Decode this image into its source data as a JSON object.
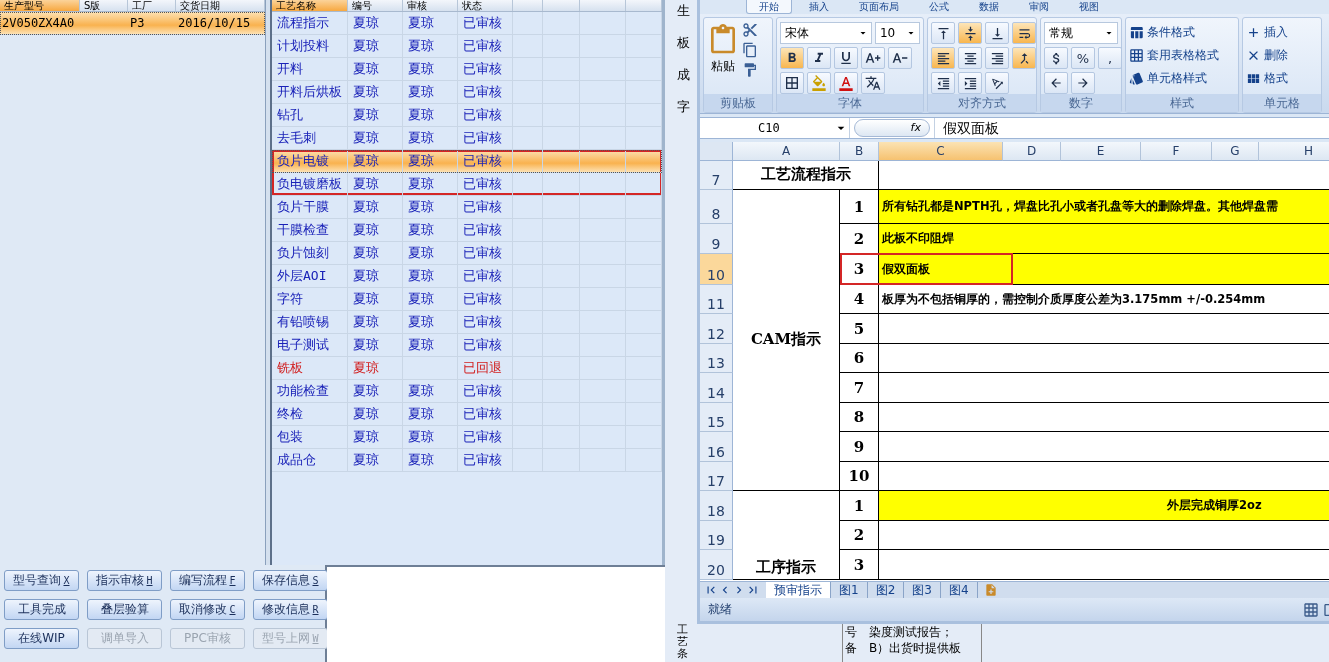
{
  "order_list": {
    "columns": [
      "生产型号",
      "S版",
      "工厂",
      "交货日期"
    ],
    "rows": [
      {
        "cells": [
          "2V050ZX4A0",
          "",
          "P3",
          "2016/10/15"
        ],
        "selected": true
      }
    ]
  },
  "process_table": {
    "columns": [
      "工艺名称",
      "编号",
      "审核",
      "状态"
    ],
    "rows": [
      {
        "cells": [
          "流程指示",
          "夏琼",
          "夏琼",
          "已审核"
        ],
        "kind": "approved",
        "selected": false,
        "outlined": false
      },
      {
        "cells": [
          "计划投料",
          "夏琼",
          "夏琼",
          "已审核"
        ],
        "kind": "approved",
        "selected": false,
        "outlined": false
      },
      {
        "cells": [
          "开料",
          "夏琼",
          "夏琼",
          "已审核"
        ],
        "kind": "approved",
        "selected": false,
        "outlined": false
      },
      {
        "cells": [
          "开料后烘板",
          "夏琼",
          "夏琼",
          "已审核"
        ],
        "kind": "approved",
        "selected": false,
        "outlined": false
      },
      {
        "cells": [
          "钻孔",
          "夏琼",
          "夏琼",
          "已审核"
        ],
        "kind": "approved",
        "selected": false,
        "outlined": false
      },
      {
        "cells": [
          "去毛刺",
          "夏琼",
          "夏琼",
          "已审核"
        ],
        "kind": "approved",
        "selected": false,
        "outlined": false
      },
      {
        "cells": [
          "负片电镀",
          "夏琼",
          "夏琼",
          "已审核"
        ],
        "kind": "approved",
        "selected": true,
        "outlined": true
      },
      {
        "cells": [
          "负电镀磨板",
          "夏琼",
          "夏琼",
          "已审核"
        ],
        "kind": "approved",
        "selected": false,
        "outlined": true
      },
      {
        "cells": [
          "负片干膜",
          "夏琼",
          "夏琼",
          "已审核"
        ],
        "kind": "approved",
        "selected": false,
        "outlined": false
      },
      {
        "cells": [
          "干膜检查",
          "夏琼",
          "夏琼",
          "已审核"
        ],
        "kind": "approved",
        "selected": false,
        "outlined": false
      },
      {
        "cells": [
          "负片蚀刻",
          "夏琼",
          "夏琼",
          "已审核"
        ],
        "kind": "approved",
        "selected": false,
        "outlined": false
      },
      {
        "cells": [
          "外层AOI",
          "夏琼",
          "夏琼",
          "已审核"
        ],
        "kind": "approved",
        "selected": false,
        "outlined": false
      },
      {
        "cells": [
          "字符",
          "夏琼",
          "夏琼",
          "已审核"
        ],
        "kind": "approved",
        "selected": false,
        "outlined": false
      },
      {
        "cells": [
          "有铅喷锡",
          "夏琼",
          "夏琼",
          "已审核"
        ],
        "kind": "approved",
        "selected": false,
        "outlined": false
      },
      {
        "cells": [
          "电子测试",
          "夏琼",
          "夏琼",
          "已审核"
        ],
        "kind": "approved",
        "selected": false,
        "outlined": false
      },
      {
        "cells": [
          "铣板",
          "夏琼",
          "",
          "已回退"
        ],
        "kind": "returned",
        "selected": false,
        "outlined": false
      },
      {
        "cells": [
          "功能检查",
          "夏琼",
          "夏琼",
          "已审核"
        ],
        "kind": "approved",
        "selected": false,
        "outlined": false
      },
      {
        "cells": [
          "终检",
          "夏琼",
          "夏琼",
          "已审核"
        ],
        "kind": "approved",
        "selected": false,
        "outlined": false
      },
      {
        "cells": [
          "包装",
          "夏琼",
          "夏琼",
          "已审核"
        ],
        "kind": "approved",
        "selected": false,
        "outlined": false
      },
      {
        "cells": [
          "成品仓",
          "夏琼",
          "夏琼",
          "已审核"
        ],
        "kind": "approved",
        "selected": false,
        "outlined": false
      }
    ]
  },
  "buttons": [
    {
      "label": "型号查询",
      "hotkey": "X",
      "disabled": false
    },
    {
      "label": "指示审核",
      "hotkey": "H",
      "disabled": false
    },
    {
      "label": "编写流程",
      "hotkey": "F",
      "disabled": false
    },
    {
      "label": "保存信息",
      "hotkey": "S",
      "disabled": false
    },
    {
      "label": "工具完成",
      "disabled": false
    },
    {
      "label": "叠层验算",
      "disabled": false
    },
    {
      "label": "取消修改",
      "hotkey": "C",
      "disabled": false
    },
    {
      "label": "修改信息",
      "hotkey": "R",
      "disabled": false
    },
    {
      "label": "在线WIP",
      "disabled": false
    },
    {
      "label": "调单导入",
      "disabled": true
    },
    {
      "label": "PPC审核",
      "disabled": true
    },
    {
      "label": "型号上网",
      "hotkey": "W",
      "disabled": true
    }
  ],
  "background_form": {
    "labels_top": [
      "生",
      "板",
      "成",
      "字"
    ],
    "labels_bottom": [
      "工",
      "艺",
      "条"
    ],
    "notes": [
      {
        "key": "号",
        "text": "染度测试报告；"
      },
      {
        "key": "备",
        "text": "B）出货时提供板"
      }
    ]
  },
  "excel": {
    "tabs": [
      {
        "label": "开始",
        "selected": true
      },
      {
        "label": "插入",
        "selected": false
      },
      {
        "label": "页面布局",
        "selected": false
      },
      {
        "label": "公式",
        "selected": false
      },
      {
        "label": "数据",
        "selected": false
      },
      {
        "label": "审阅",
        "selected": false
      },
      {
        "label": "视图",
        "selected": false
      }
    ],
    "ribbon": {
      "clipboard": {
        "title": "剪贴板",
        "paste": "粘贴"
      },
      "font": {
        "title": "字体",
        "name": "宋体",
        "size": "10",
        "bold": true
      },
      "alignment": {
        "title": "对齐方式",
        "buttons": [
          {
            "kind": "top",
            "selected": false
          },
          {
            "kind": "middle",
            "selected": true
          },
          {
            "kind": "bottom",
            "selected": false
          },
          {
            "kind": "wrap",
            "selected": true
          },
          {
            "kind": "left",
            "selected": true
          },
          {
            "kind": "center",
            "selected": false
          },
          {
            "kind": "right",
            "selected": false
          },
          {
            "kind": "merge",
            "selected": true
          }
        ]
      },
      "number": {
        "title": "数字",
        "format": "常规",
        "symbols": [
          "%",
          ","
        ]
      },
      "styles": {
        "title": "样式",
        "items": [
          "条件格式",
          "套用表格格式",
          "单元格样式"
        ]
      },
      "cells": {
        "title": "单元格",
        "items": [
          "插入",
          "删除",
          "格式"
        ]
      }
    },
    "name_box": "C10",
    "fx": "fx",
    "formula": "假双面板",
    "columns": [
      {
        "label": "A",
        "selected": false
      },
      {
        "label": "B",
        "selected": false
      },
      {
        "label": "C",
        "selected": true
      },
      {
        "label": "D",
        "selected": false
      },
      {
        "label": "E",
        "selected": false
      },
      {
        "label": "F",
        "selected": false
      },
      {
        "label": "G",
        "selected": false
      },
      {
        "label": "H",
        "selected": false
      }
    ],
    "sections": [
      {
        "kind": "title",
        "label": "工艺流程指示",
        "rows": [
          {
            "row": "7",
            "selected": false
          }
        ]
      },
      {
        "kind": "list",
        "label": "CAM指示",
        "rows": [
          {
            "row": "8",
            "number": "1",
            "text": "所有钻孔都是NPTH孔，焊盘比孔小或者孔盘等大的删除焊盘。其他焊盘需",
            "highlighted": true,
            "selected": false,
            "outlined": false
          },
          {
            "row": "9",
            "number": "2",
            "text": "此板不印阻焊",
            "highlighted": true,
            "selected": false,
            "outlined": false
          },
          {
            "row": "10",
            "number": "3",
            "text": "假双面板",
            "highlighted": true,
            "selected": true,
            "outlined": true
          },
          {
            "row": "11",
            "number": "4",
            "text": "板厚为不包括铜厚的，需控制介质厚度公差为3.175mm +/-0.254mm",
            "highlighted": false,
            "selected": false,
            "outlined": false
          },
          {
            "row": "12",
            "number": "5",
            "selected": false,
            "outlined": false
          },
          {
            "row": "13",
            "number": "6",
            "selected": false,
            "outlined": false
          },
          {
            "row": "14",
            "number": "7",
            "selected": false,
            "outlined": false
          },
          {
            "row": "15",
            "number": "8",
            "selected": false,
            "outlined": false
          },
          {
            "row": "16",
            "number": "9",
            "selected": false,
            "outlined": false
          },
          {
            "row": "17",
            "number": "10",
            "selected": false,
            "outlined": false
          }
        ]
      },
      {
        "kind": "list",
        "label": "工序指示",
        "rows": [
          {
            "row": "18",
            "number": "1",
            "text": "外层完成铜厚2oz",
            "highlighted": true,
            "selected": false,
            "outlined": false
          },
          {
            "row": "19",
            "number": "2",
            "selected": false,
            "outlined": false
          },
          {
            "row": "20",
            "number": "3",
            "selected": false,
            "outlined": false
          }
        ]
      }
    ],
    "sheet_tabs": [
      {
        "label": "预审指示",
        "selected": true
      },
      {
        "label": "图1",
        "selected": false
      },
      {
        "label": "图2",
        "selected": false
      },
      {
        "label": "图3",
        "selected": false
      },
      {
        "label": "图4",
        "selected": false
      }
    ],
    "status": "就绪"
  }
}
